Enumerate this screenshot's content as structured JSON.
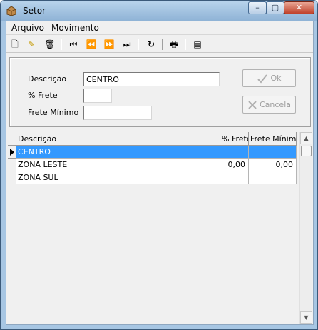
{
  "window": {
    "title": "Setor",
    "min_glyph": "–",
    "max_glyph": "▢",
    "close_glyph": "✕"
  },
  "menu": {
    "items": [
      {
        "label": "Arquivo"
      },
      {
        "label": "Movimento"
      }
    ]
  },
  "toolbar": {
    "icons": [
      "new-icon",
      "edit-icon",
      "delete-icon",
      "first-icon",
      "previous-icon",
      "next-icon",
      "last-icon",
      "refresh-icon",
      "print-icon",
      "properties-icon"
    ],
    "glyphs": {
      "new": "🗋",
      "edit": "✎",
      "delete": "🗑",
      "first": "⏮",
      "previous": "⏪",
      "next": "⏩",
      "last": "⏭",
      "refresh": "↻",
      "print": "🖶",
      "properties": "▤"
    }
  },
  "form": {
    "descricao_label": "Descrição",
    "descricao_value": "CENTRO",
    "frete_label": "% Frete",
    "frete_value": "",
    "frete_minimo_label": "Frete Mínimo",
    "frete_minimo_value": "",
    "ok_label": "Ok",
    "cancel_label": "Cancela"
  },
  "grid": {
    "columns": [
      "Descrição",
      "% Frete",
      "Frete Mínimo"
    ],
    "rows": [
      {
        "descricao": "CENTRO",
        "frete": "",
        "frete_minimo": "",
        "selected": true
      },
      {
        "descricao": "ZONA LESTE",
        "frete": "0,00",
        "frete_minimo": "0,00",
        "selected": false
      },
      {
        "descricao": "ZONA SUL",
        "frete": "",
        "frete_minimo": "",
        "selected": false
      }
    ]
  },
  "scrollbar": {
    "up_glyph": "▲",
    "down_glyph": "▼"
  }
}
